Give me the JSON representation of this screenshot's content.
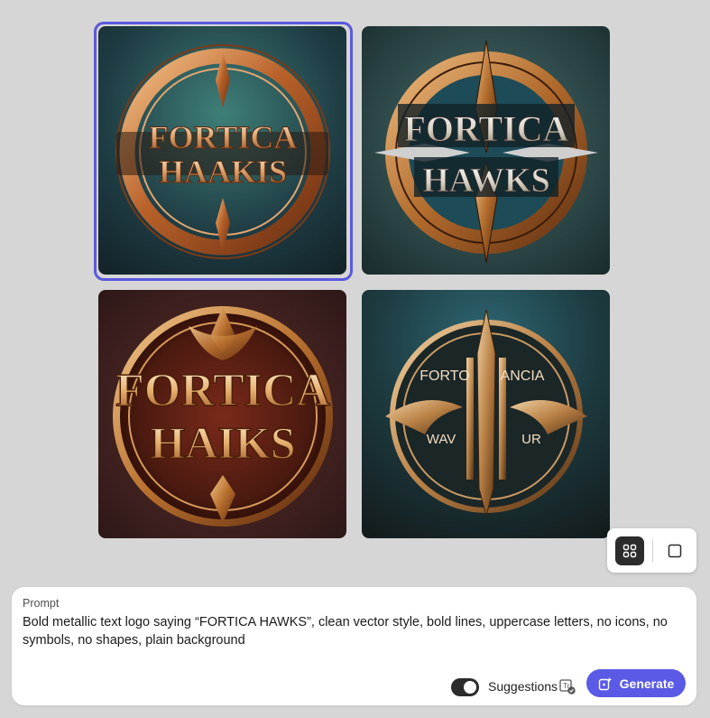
{
  "gallery": {
    "images": [
      {
        "line1": "FORTICA",
        "line2": "HAAKIS",
        "selected": true
      },
      {
        "line1": "FORTICA",
        "line2": "HAWKS",
        "selected": false
      },
      {
        "line1": "FORTICA",
        "line2": "HAIKS",
        "selected": false
      },
      {
        "line1": "FORTO",
        "line2": "ANCIA",
        "line3": "WAV",
        "line4": "UR",
        "selected": false
      }
    ]
  },
  "view_toggle": {
    "grid_icon": "grid-icon",
    "single_icon": "square-icon"
  },
  "prompt": {
    "label": "Prompt",
    "text": "Bold metallic text logo saying “FORTICA HAWKS”, clean vector style, bold lines, uppercase letters, no icons, no symbols, no shapes, plain background"
  },
  "controls": {
    "suggestions_label": "Suggestions",
    "suggestions_on": true,
    "generate_label": "Generate"
  },
  "colors": {
    "accent": "#5a5ae6",
    "selection_ring": "#5a58e0",
    "background": "#d6d6d6"
  }
}
